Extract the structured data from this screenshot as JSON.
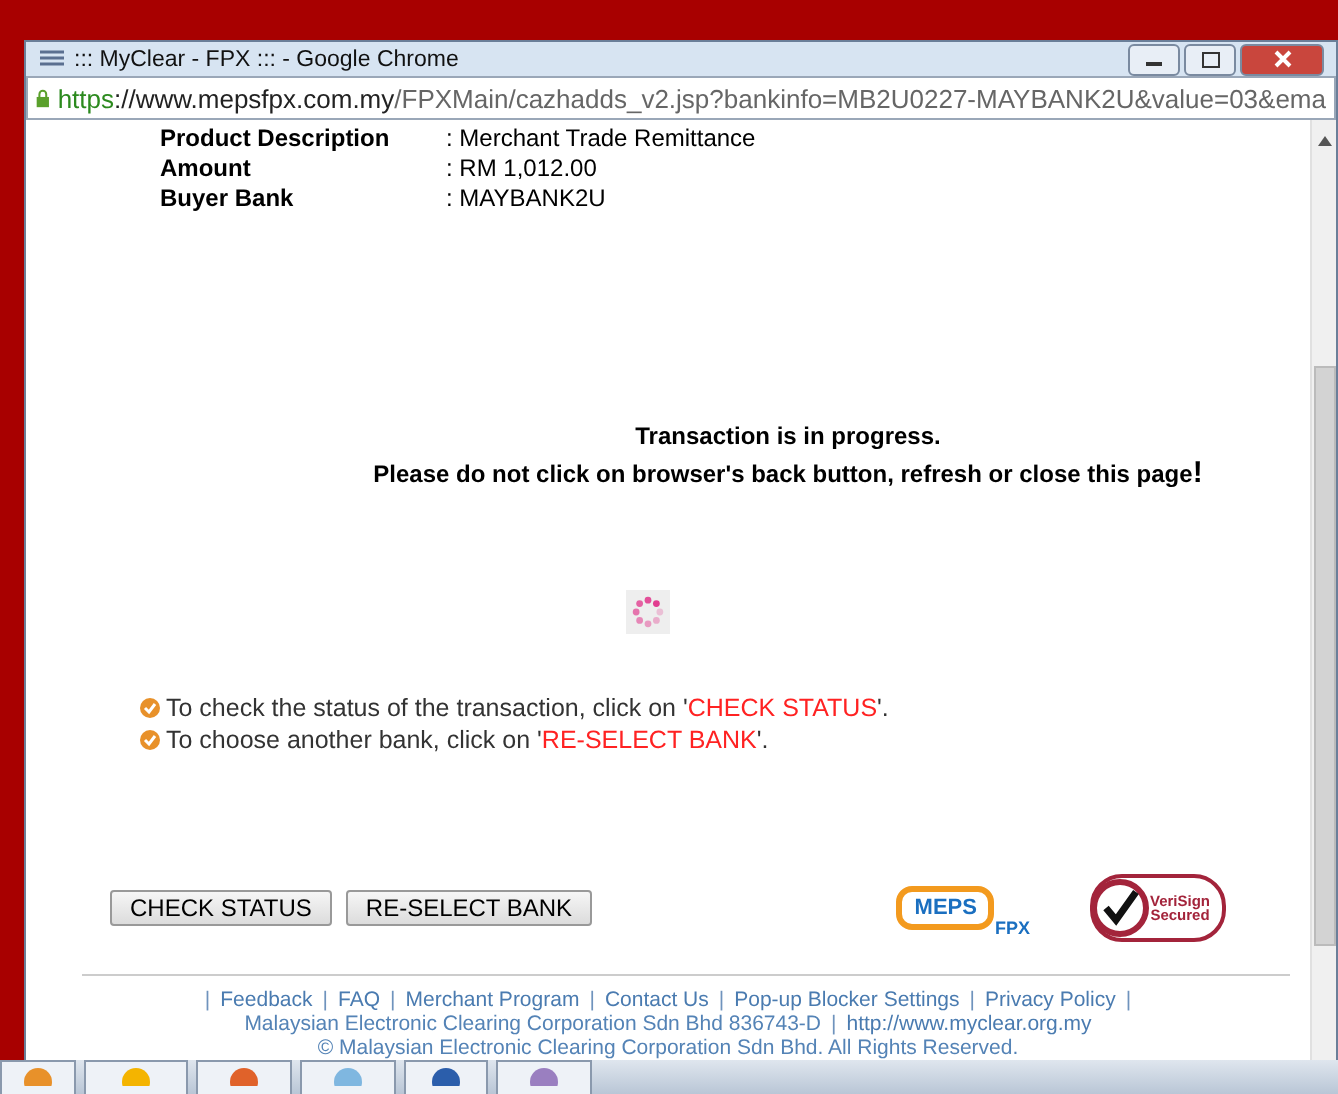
{
  "window": {
    "title": "::: MyClear - FPX ::: - Google Chrome"
  },
  "address_bar": {
    "scheme": "https",
    "host": "://www.mepsfpx.com.my",
    "path": "/FPXMain/cazhadds_v2.jsp?bankinfo=MB2U0227-MAYBANK2U&value=03&ema"
  },
  "details": [
    {
      "label": "Product Description",
      "value": ": Merchant Trade Remittance"
    },
    {
      "label": "Amount",
      "value": ": RM 1,012.00"
    },
    {
      "label": "Buyer Bank",
      "value": ": MAYBANK2U"
    }
  ],
  "status": {
    "title": "Transaction is in progress.",
    "warning": "Please do not click on browser's back button, refresh or close this page",
    "mark": "!"
  },
  "notes": [
    {
      "before": "To check the status of the transaction, click on '",
      "highlight": "CHECK STATUS",
      "after": "'."
    },
    {
      "before": "To choose another bank, click on '",
      "highlight": "RE-SELECT BANK",
      "after": "'."
    }
  ],
  "buttons": [
    "CHECK STATUS",
    "RE-SELECT BANK"
  ],
  "logos": {
    "meps": "MEPS",
    "fpx": "FPX",
    "verisign": [
      "VeriSign",
      "Secured"
    ]
  },
  "footer": {
    "lines": [
      [
        {
          "kind": "separator",
          "text": "|"
        },
        {
          "kind": "link",
          "text": "Feedback"
        },
        {
          "kind": "separator",
          "text": "|"
        },
        {
          "kind": "link",
          "text": "FAQ"
        },
        {
          "kind": "separator",
          "text": "|"
        },
        {
          "kind": "link",
          "text": "Merchant Program"
        },
        {
          "kind": "separator",
          "text": "|"
        },
        {
          "kind": "link",
          "text": "Contact Us"
        },
        {
          "kind": "separator",
          "text": "|"
        },
        {
          "kind": "link",
          "text": "Pop-up Blocker Settings"
        },
        {
          "kind": "separator",
          "text": "|"
        },
        {
          "kind": "link",
          "text": "Privacy Policy"
        },
        {
          "kind": "separator",
          "text": "|"
        }
      ],
      [
        {
          "kind": "text",
          "text": "Malaysian Electronic Clearing Corporation Sdn Bhd 836743-D"
        },
        {
          "kind": "separator",
          "text": "|"
        },
        {
          "kind": "link",
          "text": "http://www.myclear.org.my"
        }
      ],
      [
        {
          "kind": "text",
          "text": "© Malaysian Electronic Clearing Corporation Sdn Bhd. All Rights Reserved."
        }
      ]
    ]
  }
}
